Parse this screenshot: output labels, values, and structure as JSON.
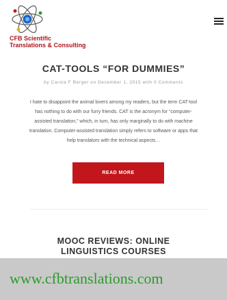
{
  "header": {
    "brand_line1": "CFB Scientific",
    "brand_line2": "Translations & Consulting",
    "logo_icon": "atom-logo-icon",
    "menu_icon": "hamburger-menu-icon"
  },
  "post1": {
    "title": "CAT-TOOLS “FOR DUMMIES”",
    "meta": "by Carola F Berger on December 1, 2015 with 0 Comments",
    "excerpt": "I hate to disappoint the animal lovers among my readers, but the term CAT-tool has nothing to do with our furry friends. CAT is the acronym for “computer-assisted translation,” which, in turn, has only marginally to do with machine translation. Computer-assisted translation simply refers to software or apps that help translators with the technical aspects…",
    "read_more": "READ MORE"
  },
  "post2": {
    "title_line1": "MOOC REVIEWS: ONLINE",
    "title_line2": "LINGUISTICS COURSES"
  },
  "footer": {
    "url": "www.cfbtranslations.com"
  },
  "colors": {
    "accent": "#c1161c",
    "footer_text": "#2a9b2a",
    "footer_band": "#c9c9c9"
  }
}
